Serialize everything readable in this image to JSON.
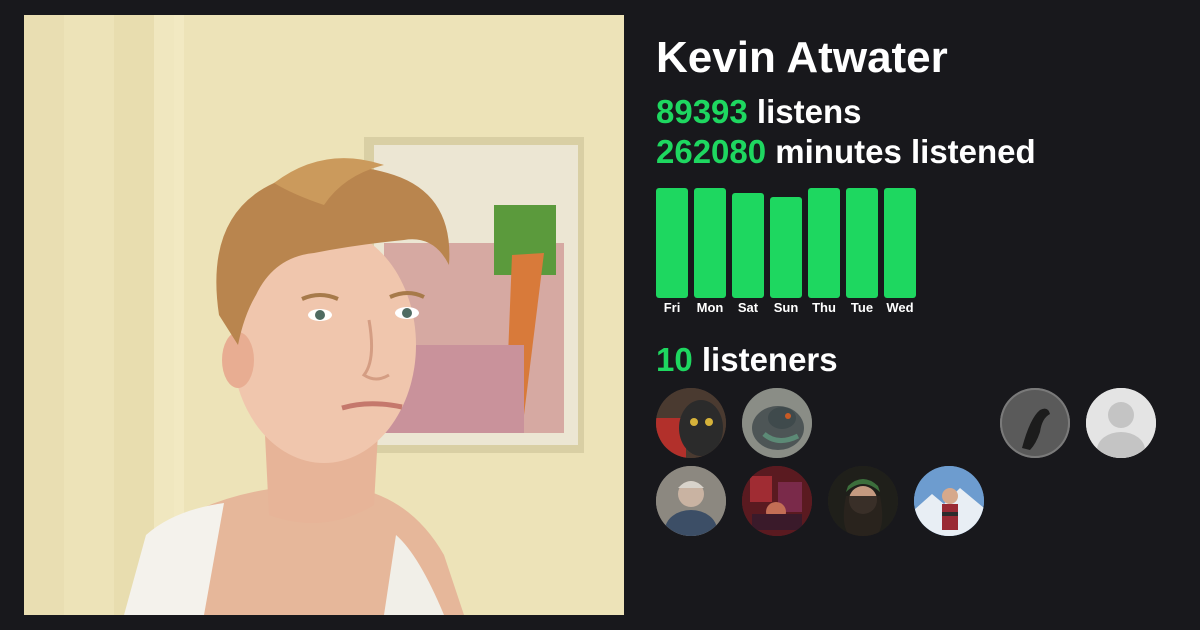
{
  "artist": {
    "name": "Kevin Atwater"
  },
  "stats": {
    "listens_value": "89393",
    "listens_label": " listens",
    "minutes_value": "262080",
    "minutes_label": " minutes listened",
    "listeners_value": "10",
    "listeners_label": " listeners"
  },
  "chart_data": {
    "type": "bar",
    "categories": [
      "Fri",
      "Mon",
      "Sat",
      "Sun",
      "Thu",
      "Tue",
      "Wed"
    ],
    "values": [
      100,
      100,
      95,
      92,
      100,
      100,
      100
    ],
    "ylim": [
      0,
      100
    ],
    "color": "#1ed760",
    "grid": false
  },
  "colors": {
    "background": "#18181c",
    "accent": "#1ed760",
    "text": "#ffffff"
  },
  "listeners": [
    {
      "icon": "cat-photo-avatar",
      "bg": "#4a3a30"
    },
    {
      "icon": "pigeon-photo-avatar",
      "bg": "#5c6160"
    },
    {
      "icon": "bird-silhouette-avatar",
      "bg": "#6e6e6e"
    },
    {
      "icon": "default-user-avatar",
      "bg": "#e6e6e6"
    },
    {
      "icon": "person-photo-avatar",
      "bg": "#8a8680"
    },
    {
      "icon": "red-photo-avatar",
      "bg": "#6a2026"
    },
    {
      "icon": "person-photo-avatar",
      "bg": "#2a2a24"
    },
    {
      "icon": "person-mountains-photo-avatar",
      "bg": "#6f9ac7"
    }
  ]
}
